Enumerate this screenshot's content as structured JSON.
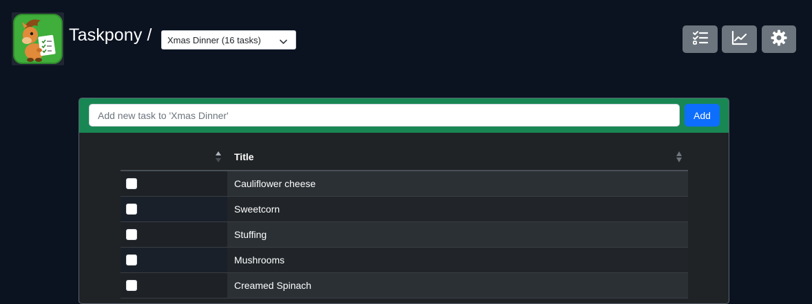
{
  "app": {
    "name": "Taskpony /",
    "selected_list": "Xmas Dinner (16 tasks)"
  },
  "header_buttons": [
    {
      "icon": "task-list-icon"
    },
    {
      "icon": "chart-line-icon"
    },
    {
      "icon": "gear-icon"
    }
  ],
  "colors": {
    "background": "#0b1220",
    "panel_header": "#198754",
    "primary": "#0d6efd",
    "secondary_button": "#6c757d"
  },
  "task_form": {
    "placeholder": "Add new task to 'Xmas Dinner'",
    "add_label": "Add"
  },
  "table": {
    "title_header": "Title",
    "rows": [
      {
        "title": "Cauliflower cheese",
        "checked": false
      },
      {
        "title": "Sweetcorn",
        "checked": false
      },
      {
        "title": "Stuffing",
        "checked": false
      },
      {
        "title": "Mushrooms",
        "checked": false
      },
      {
        "title": "Creamed Spinach",
        "checked": false
      }
    ]
  }
}
